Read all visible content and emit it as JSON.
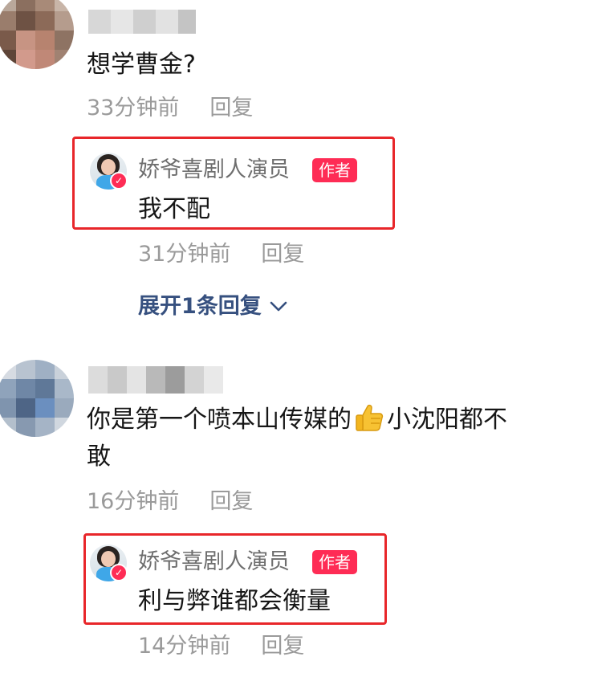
{
  "comments": [
    {
      "text": "想学曹金?",
      "time": "33分钟前",
      "reply_label": "回复",
      "author_reply": {
        "name": "娇爷喜剧人演员",
        "badge": "作者",
        "text": "我不配",
        "time": "31分钟前",
        "reply_label": "回复"
      },
      "expand_label": "展开1条回复"
    },
    {
      "text_before_emoji": "你是第一个喷本山传媒的",
      "emoji": "thumbs-up-icon",
      "text_after_emoji": "小沈阳都不",
      "text_line2": "敢",
      "time": "16分钟前",
      "reply_label": "回复",
      "author_reply": {
        "name": "娇爷喜剧人演员",
        "badge": "作者",
        "text": "利与弊谁都会衡量",
        "time": "14分钟前",
        "reply_label": "回复"
      }
    }
  ],
  "colors": {
    "highlight_frame": "#e8262a",
    "author_badge": "#fe2c55",
    "expand_link": "#36507f",
    "meta_text": "#9a9a9a"
  }
}
